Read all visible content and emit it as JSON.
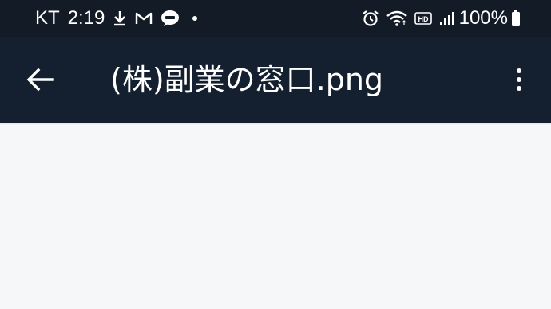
{
  "status_bar": {
    "carrier": "KT",
    "time": "2:19",
    "battery_percent": "100%",
    "icons_left": [
      "download-icon",
      "gmail-icon",
      "band-icon",
      "notification-dot-icon"
    ],
    "icons_right": [
      "alarm-icon",
      "wifi-icon",
      "hd-voice-icon",
      "signal-icon",
      "battery-icon"
    ]
  },
  "app_bar": {
    "title": "(株)副業の窓口.png",
    "back_icon": "arrow-back-icon",
    "menu_icon": "more-vert-icon"
  },
  "colors": {
    "status_bar_bg": "#131b26",
    "app_bar_bg": "#14202f",
    "content_bg": "#f6f7f9",
    "foreground": "#ffffff"
  }
}
